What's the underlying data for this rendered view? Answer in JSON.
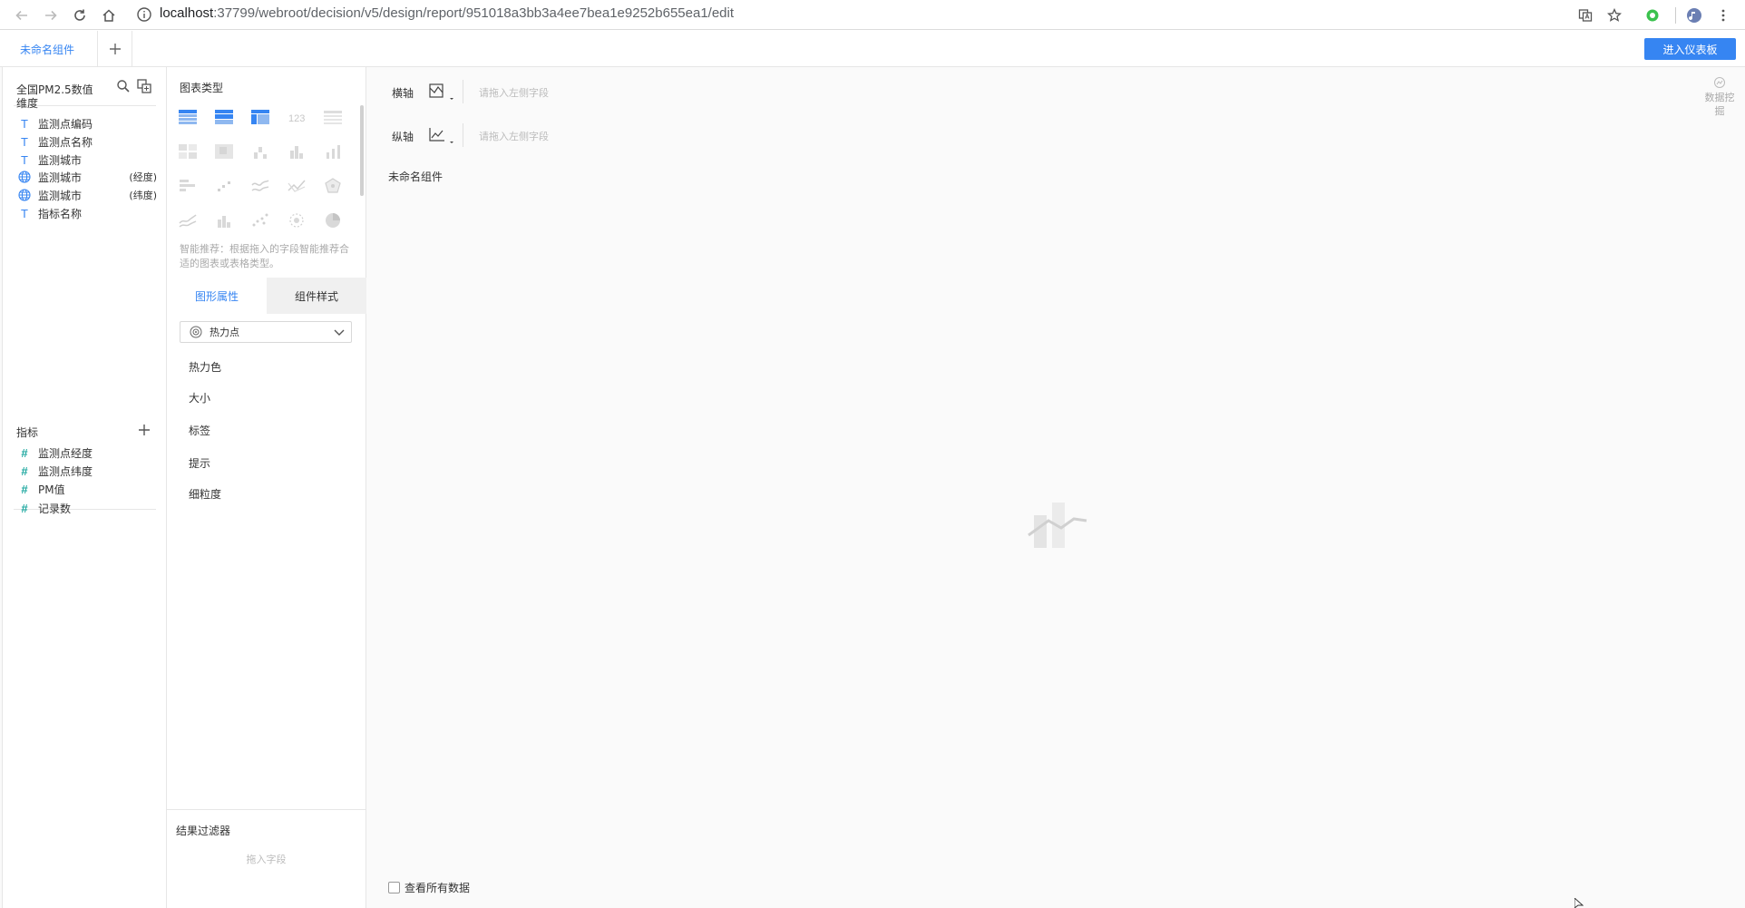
{
  "browser": {
    "url_host": "localhost",
    "url_rest": ":37799/webroot/decision/v5/design/report/951018a3bb3a4ee7bea1e9252b655ea1/edit"
  },
  "tabs": {
    "active_label": "未命名组件",
    "enter_dashboard_label": "进入仪表板"
  },
  "fields": {
    "datasource_name": "全国PM2.5数值",
    "dimensions_title": "维度",
    "dimensions": [
      {
        "icon": "text-field-icon",
        "label": "监测点编码",
        "suffix": ""
      },
      {
        "icon": "text-field-icon",
        "label": "监测点名称",
        "suffix": ""
      },
      {
        "icon": "text-field-icon",
        "label": "监测城市",
        "suffix": ""
      },
      {
        "icon": "globe-icon",
        "label": "监测城市",
        "suffix": "(经度)"
      },
      {
        "icon": "globe-icon",
        "label": "监测城市",
        "suffix": "(纬度)"
      },
      {
        "icon": "text-field-icon",
        "label": "指标名称",
        "suffix": ""
      }
    ],
    "metrics_title": "指标",
    "metrics": [
      {
        "icon": "number-field-icon",
        "label": "监测点经度"
      },
      {
        "icon": "number-field-icon",
        "label": "监测点纬度"
      },
      {
        "icon": "number-field-icon",
        "label": "PM值"
      },
      {
        "icon": "number-field-icon",
        "label": "记录数"
      }
    ]
  },
  "config": {
    "chart_type_title": "图表类型",
    "recommend_text": "智能推荐：根据拖入的字段智能推荐合适的图表或表格类型。",
    "tab_graph_props": "图形属性",
    "tab_component_style": "组件样式",
    "selected_type": "热力点",
    "props": [
      "热力色",
      "大小",
      "标签",
      "提示",
      "细粒度"
    ],
    "filter_title": "结果过滤器",
    "filter_hint": "拖入字段"
  },
  "canvas": {
    "x_axis_label": "横轴",
    "y_axis_label": "纵轴",
    "drop_hint": "请拖入左侧字段",
    "component_title": "未命名组件",
    "mining_label": "数据挖掘",
    "view_all_label": "查看所有数据"
  },
  "colors": {
    "accent": "#3685f2",
    "number_field": "#1fa8a0"
  }
}
